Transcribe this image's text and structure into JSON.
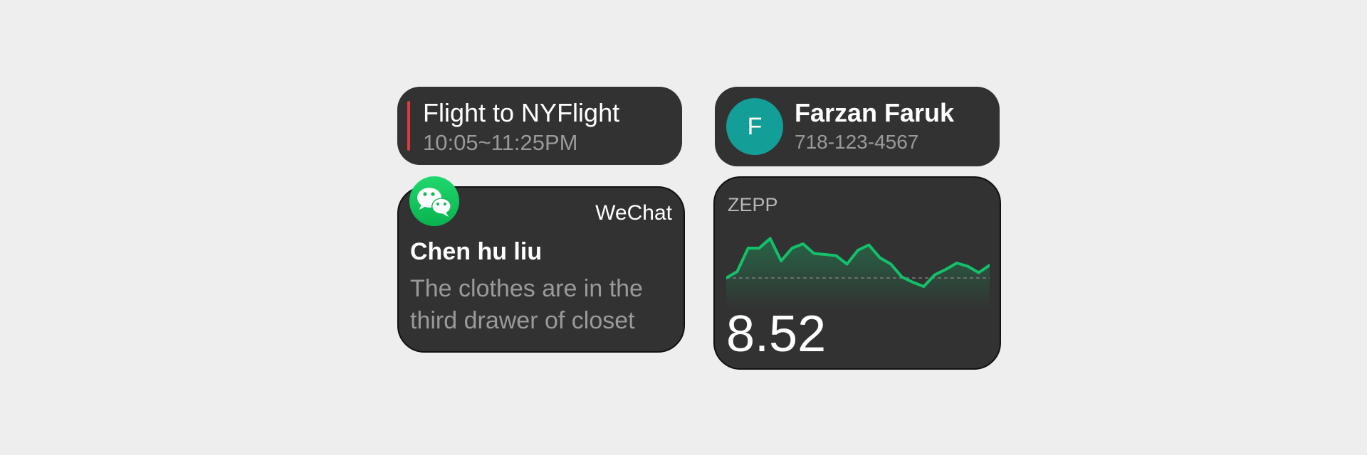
{
  "flight": {
    "title": "Flight to NYFlight",
    "time": "10:05~11:25PM",
    "accent_color": "#e03a3a"
  },
  "contact": {
    "avatar_letter": "F",
    "name": "Farzan Faruk",
    "phone": "718-123-4567",
    "avatar_color": "#139e98"
  },
  "wechat": {
    "app_name": "WeChat",
    "sender": "Chen hu liu",
    "message": "The clothes are in the third drawer of closet",
    "icon": "wechat-icon",
    "icon_color": "#10c15a"
  },
  "zepp": {
    "label": "ZEPP",
    "value": "8.52",
    "line_color": "#12c16a"
  },
  "chart_data": {
    "type": "area",
    "baseline": 0,
    "x": [
      0,
      1,
      2,
      3,
      4,
      5,
      6,
      7,
      8,
      9,
      10,
      11,
      12,
      13,
      14,
      15,
      16,
      17,
      18,
      19,
      20,
      21,
      22,
      23,
      24,
      25,
      26,
      27,
      28,
      29
    ],
    "values": [
      0,
      0.6,
      2.8,
      2.8,
      3.7,
      1.6,
      2.8,
      3.2,
      2.3,
      2.2,
      2.1,
      1.3,
      2.6,
      3.1,
      1.9,
      1.3,
      0.1,
      -0.4,
      -0.8,
      0.3,
      0.8,
      1.4,
      1.1,
      0.5,
      1.2
    ],
    "ylim": [
      -3,
      5
    ]
  }
}
